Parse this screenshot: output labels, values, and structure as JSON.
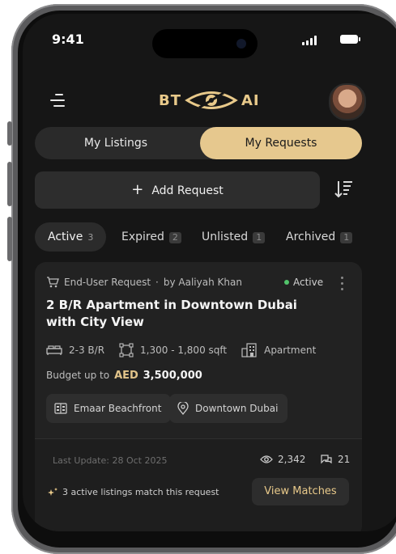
{
  "status_bar": {
    "time": "9:41"
  },
  "brand": {
    "left": "BT",
    "right": "AI"
  },
  "tabs": [
    {
      "label": "My Listings"
    },
    {
      "label": "My Requests"
    }
  ],
  "add_request": {
    "label": "Add Request"
  },
  "filters": [
    {
      "label": "Active",
      "count": "3"
    },
    {
      "label": "Expired",
      "count": "2"
    },
    {
      "label": "Unlisted",
      "count": "1"
    },
    {
      "label": "Archived",
      "count": "1"
    }
  ],
  "card": {
    "request_type": "End-User Request",
    "by_label": "by Aaliyah Khan",
    "status": "Active",
    "title": "2 B/R Apartment in Downtown Dubai with City View",
    "bedrooms": "2-3 B/R",
    "area": "1,300 - 1,800 sqft",
    "property_type": "Apartment",
    "budget_label": "Budget up to",
    "budget_currency": "AED",
    "budget_value": "3,500,000",
    "tags": [
      "Emaar Beachfront",
      "Downtown Dubai"
    ],
    "last_update": "Last Update: 28 Oct 2025",
    "views": "2,342",
    "comments": "21",
    "matches_text": "3 active listings match this request",
    "view_matches": "View Matches"
  },
  "colors": {
    "accent": "#e6c88e",
    "status_active": "#52c46b",
    "background": "#161616"
  }
}
